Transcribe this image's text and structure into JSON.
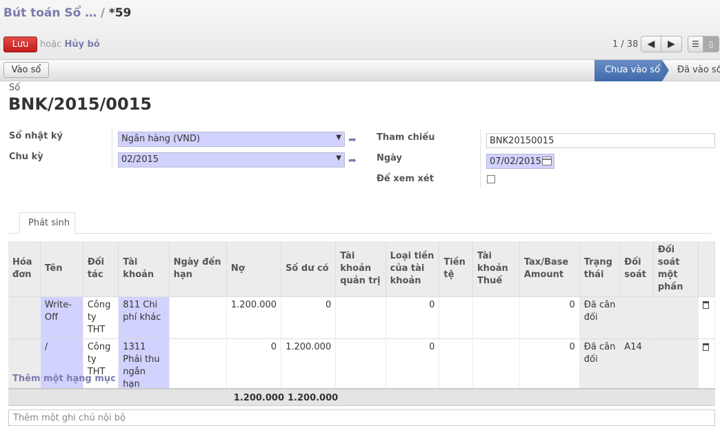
{
  "header": {
    "breadcrumb_parent": "Bút toán Sổ …",
    "breadcrumb_sep": "/",
    "breadcrumb_current": "*59",
    "save_label": "Lưu",
    "or_label": "hoặc",
    "discard_label": "Hủy bỏ",
    "pager": "1 / 38"
  },
  "statusbar": {
    "post_button": "Vào sổ",
    "stage_active": "Chưa vào sổ",
    "stage_next": "Đã vào sổ"
  },
  "form": {
    "number_label": "Số",
    "number_value": "BNK/2015/0015",
    "journal_label": "Sổ nhật ký",
    "journal_value": "Ngân hàng (VND)",
    "period_label": "Chu kỳ",
    "period_value": "02/2015",
    "ref_label": "Tham chiếu",
    "ref_value": "BNK20150015",
    "date_label": "Ngày",
    "date_value": "07/02/2015",
    "review_label": "Để xem xét"
  },
  "tab": {
    "label": "Phát sinh"
  },
  "table": {
    "columns": [
      "Hóa đơn",
      "Tên",
      "Đối tác",
      "Tài khoản",
      "Ngày đến hạn",
      "Nợ",
      "Số dư có",
      "Tài khoản quản trị",
      "Loại tiền của tài khoản",
      "Tiền tệ",
      "Tài khoản Thuế",
      "Tax/Base Amount",
      "Trạng thái",
      "Đối soát",
      "Đối soát một phần"
    ],
    "rows": [
      {
        "name": "Write-Off",
        "partner": "Công ty THT",
        "account": "811 Chi phí khác",
        "debit": "1.200.000",
        "credit": "0",
        "currency_amount": "0",
        "tax_amount": "0",
        "state": "Đã cân đối",
        "reconcile": ""
      },
      {
        "name": "/",
        "partner": "Công ty THT",
        "account": "1311 Phải thu ngắn hạn",
        "debit": "0",
        "credit": "1.200.000",
        "currency_amount": "0",
        "tax_amount": "0",
        "state": "Đã cân đối",
        "reconcile": "A14"
      }
    ],
    "add_line": "Thêm một hạng mục",
    "total_debit": "1.200.000",
    "total_credit": "1.200.000"
  },
  "note": {
    "placeholder": "Thêm một ghi chú nội bộ"
  }
}
